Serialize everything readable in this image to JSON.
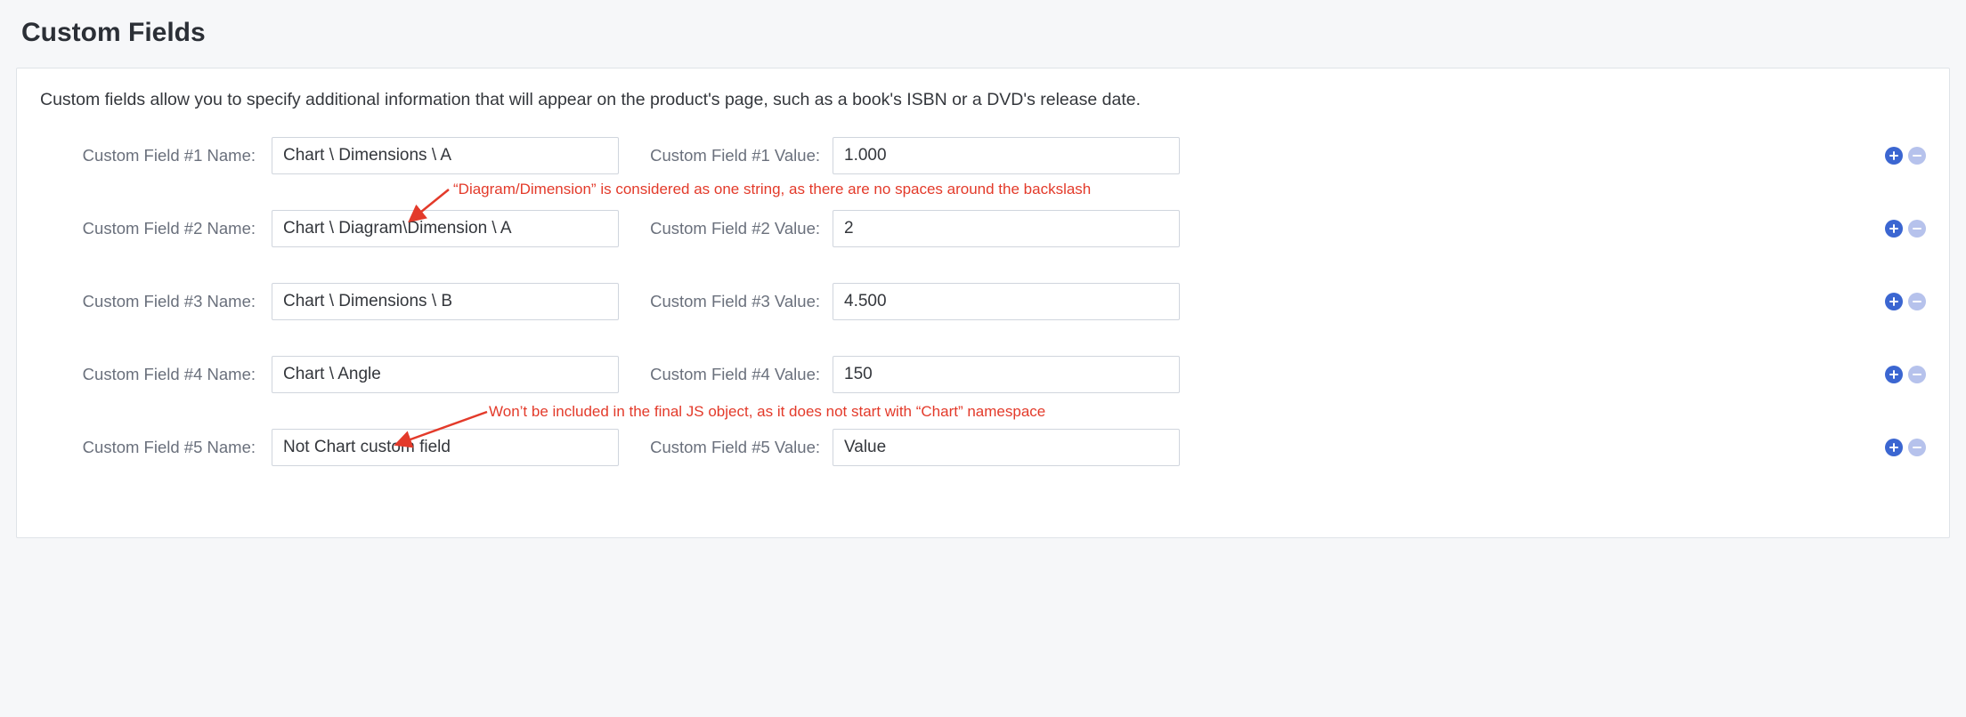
{
  "page_title": "Custom Fields",
  "description": "Custom fields allow you to specify additional information that will appear on the product's page, such as a book's ISBN or a DVD's release date.",
  "fields": [
    {
      "name_label": "Custom Field #1 Name:",
      "name_value": "Chart \\ Dimensions \\ A",
      "value_label": "Custom Field #1 Value:",
      "value_value": "1.000"
    },
    {
      "name_label": "Custom Field #2 Name:",
      "name_value": "Chart \\ Diagram\\Dimension \\ A",
      "value_label": "Custom Field #2 Value:",
      "value_value": "2"
    },
    {
      "name_label": "Custom Field #3 Name:",
      "name_value": "Chart \\ Dimensions \\ B",
      "value_label": "Custom Field #3 Value:",
      "value_value": "4.500"
    },
    {
      "name_label": "Custom Field #4 Name:",
      "name_value": "Chart \\ Angle",
      "value_label": "Custom Field #4 Value:",
      "value_value": "150"
    },
    {
      "name_label": "Custom Field #5 Name:",
      "name_value": "Not Chart custom field",
      "value_label": "Custom Field #5 Value:",
      "value_value": "Value"
    }
  ],
  "annotations": {
    "a1": "“Diagram/Dimension” is considered as one string, as there are no spaces around the backslash",
    "a2": "Won’t be included in the final JS object, as it does not start with “Chart” namespace"
  }
}
